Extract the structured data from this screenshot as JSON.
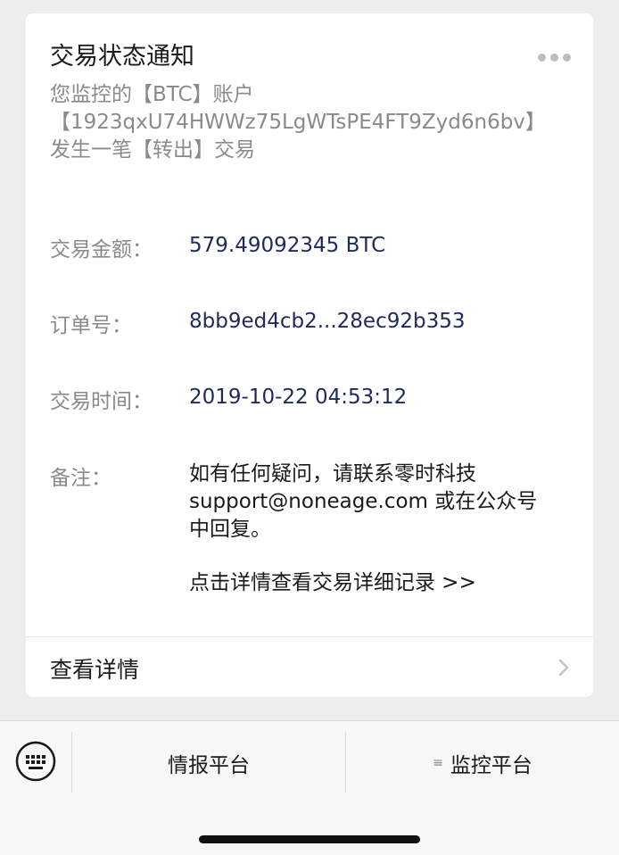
{
  "card": {
    "title": "交易状态通知",
    "intro_line1": "您监控的【BTC】账户",
    "intro_line2": "【1923qxU74HWWz75LgWTsPE4FT9Zyd6n6bv】",
    "intro_line3": "发生一笔【转出】交易",
    "fields": {
      "amount": {
        "label": "交易金额：",
        "value": "579.49092345 BTC"
      },
      "order": {
        "label": "订单号：",
        "value": "8bb9ed4cb2...28ec92b353"
      },
      "time": {
        "label": "交易时间：",
        "value": "2019-10-22 04:53:12"
      },
      "remark": {
        "label": "备注：",
        "line1": "如有任何疑问，请联系零时科技",
        "line2": "support@noneage.com 或在公众号",
        "line3": "中回复。",
        "line4": "点击详情查看交易详细记录 >>"
      }
    },
    "detail_label": "查看详情"
  },
  "menu": {
    "items": [
      {
        "label": "情报平台"
      },
      {
        "label": "监控平台",
        "icon": "≡"
      }
    ]
  }
}
